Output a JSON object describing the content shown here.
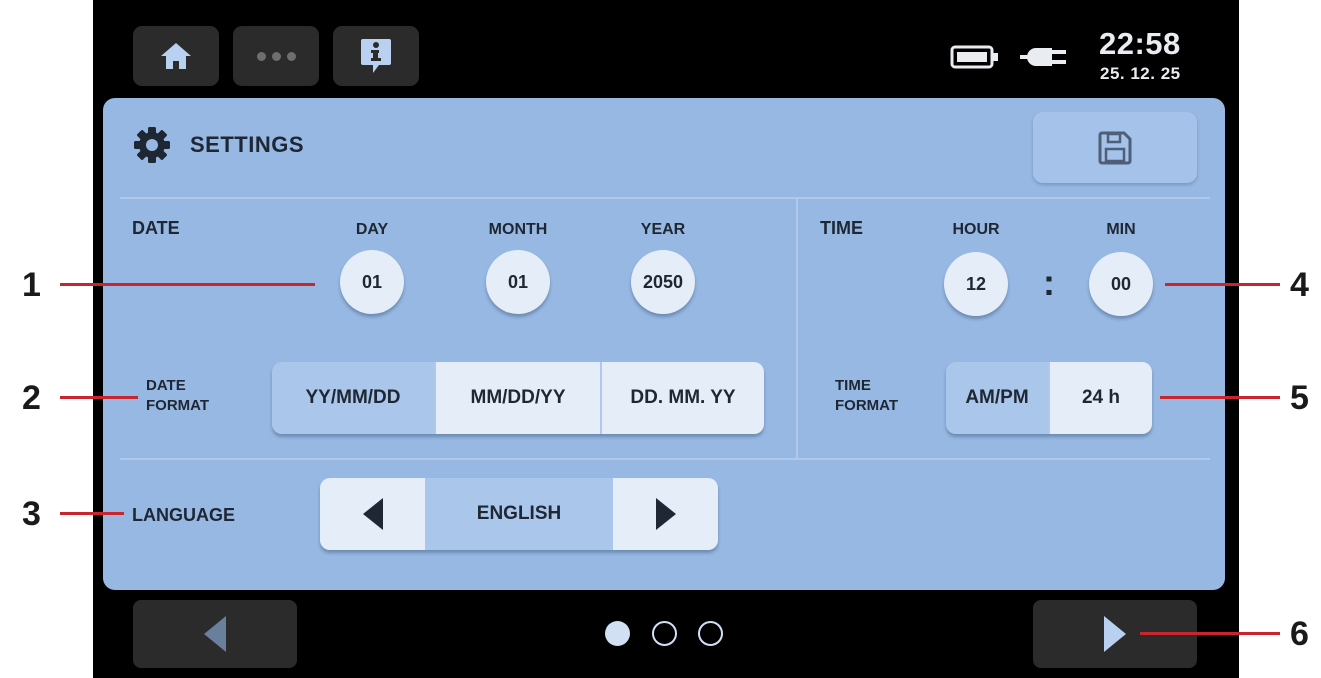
{
  "status": {
    "time": "22:58",
    "date": "25. 12. 25"
  },
  "top_buttons": {
    "home": "home-icon",
    "more": "more-icon",
    "info": "info-icon"
  },
  "settings": {
    "title": "SETTINGS",
    "save_icon": "floppy-disk-icon",
    "date": {
      "label": "DATE",
      "day_label": "DAY",
      "day": "01",
      "month_label": "MONTH",
      "month": "01",
      "year_label": "YEAR",
      "year": "2050"
    },
    "time": {
      "label": "TIME",
      "hour_label": "HOUR",
      "hour": "12",
      "min_label": "MIN",
      "min": "00",
      "separator": ":"
    },
    "date_format": {
      "label_line1": "DATE",
      "label_line2": "FORMAT",
      "options": [
        "YY/MM/DD",
        "MM/DD/YY",
        "DD. MM. YY"
      ],
      "selected": "YY/MM/DD"
    },
    "time_format": {
      "label_line1": "TIME",
      "label_line2": "FORMAT",
      "options": [
        "AM/PM",
        "24 h"
      ],
      "selected": "AM/PM"
    },
    "language": {
      "label": "LANGUAGE",
      "value": "ENGLISH"
    }
  },
  "pagination": {
    "current": 1,
    "total": 3
  },
  "callouts": [
    "1",
    "2",
    "3",
    "4",
    "5",
    "6"
  ],
  "colors": {
    "panel": "#96b8e3",
    "callout_line": "#c8252e",
    "button_light": "#e4edf8",
    "selected": "#aac6ea"
  }
}
